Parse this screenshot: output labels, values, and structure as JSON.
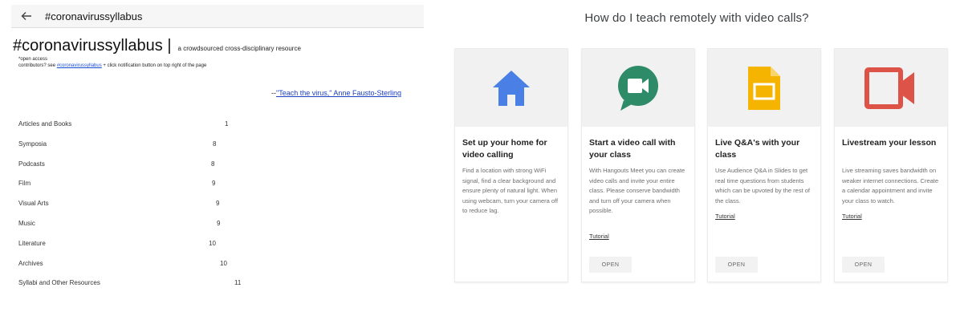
{
  "left_panel": {
    "header_title": "#coronavirussyllabus",
    "doc_title": "#coronavirussyllabus |",
    "doc_subtitle": "a crowdsourced cross-disciplinary resource",
    "note_line1": "*open access",
    "note_line2_prefix": "contributors? see ",
    "note_link": "#coronavirussyllabus",
    "note_line2_suffix": " + click notification button on top right of the page",
    "quote_prefix": "--",
    "quote_link": "\"Teach the virus,\" Anne Fausto-Sterling",
    "toc": [
      {
        "label": "Articles and Books",
        "page": "1"
      },
      {
        "label": "Symposia",
        "page": "8"
      },
      {
        "label": "Podcasts",
        "page": "8"
      },
      {
        "label": "Film",
        "page": "9"
      },
      {
        "label": "Visual Arts",
        "page": "9"
      },
      {
        "label": "Music",
        "page": "9"
      },
      {
        "label": "Literature",
        "page": "10"
      },
      {
        "label": "Archives",
        "page": "10"
      },
      {
        "label": "Syllabi and Other Resources",
        "page": "11"
      }
    ]
  },
  "right_panel": {
    "heading": "How do I teach remotely with video calls?",
    "cards": [
      {
        "icon": "home-icon",
        "title": "Set up your home for video calling",
        "body": "Find a location with strong WiFi signal, find a clear background and ensure plenty of natural light. When using webcam, turn your camera off to reduce lag.",
        "link": "",
        "button": "OPEN"
      },
      {
        "icon": "meet-icon",
        "title": "Start a video call with your class",
        "body": "With Hangouts Meet you can create video calls and invite your entire class. Please conserve bandwidth and turn off your camera when possible.",
        "link": "Tutorial",
        "button": "OPEN"
      },
      {
        "icon": "slides-icon",
        "title": "Live Q&A's with your class",
        "body": "Use Audience Q&A in Slides to get real time questions from students which can be upvoted by the rest of the class.",
        "link": "Tutorial",
        "button": "OPEN"
      },
      {
        "icon": "video-camera-icon",
        "title": "Livestream your lesson",
        "body": "Live streaming saves bandwidth on weaker internet connections. Create a calendar appointment and invite your class to watch.",
        "link": "Tutorial",
        "button": "OPEN"
      }
    ]
  }
}
